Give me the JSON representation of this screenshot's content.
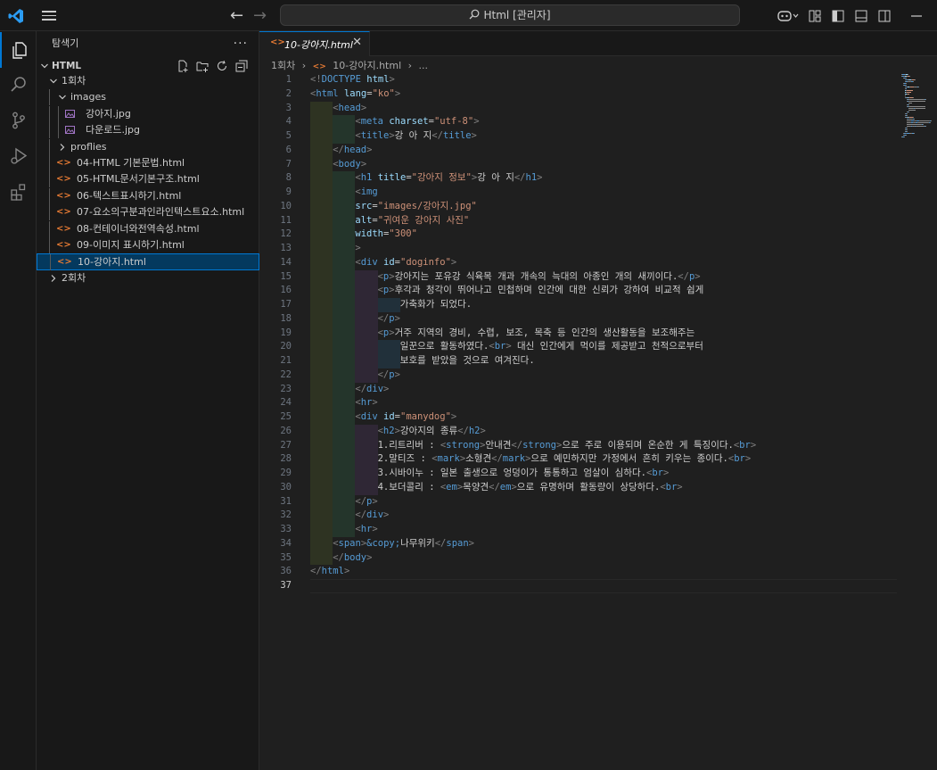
{
  "titlebar": {
    "search_text": "Html [관리자]"
  },
  "sidebar": {
    "header": "탐색기",
    "more": "···",
    "section": "HTML",
    "tree": [
      {
        "label": "1회차",
        "type": "folder",
        "depth": 1,
        "open": true
      },
      {
        "label": "images",
        "type": "folder",
        "depth": 2,
        "open": true
      },
      {
        "label": "강아지.jpg",
        "type": "image",
        "depth": 3
      },
      {
        "label": "다운로드.jpg",
        "type": "image",
        "depth": 3
      },
      {
        "label": "proflies",
        "type": "folder",
        "depth": 2,
        "open": false
      },
      {
        "label": "04-HTML 기본문법.html",
        "type": "html",
        "depth": 2
      },
      {
        "label": "05-HTML문서기본구조.html",
        "type": "html",
        "depth": 2
      },
      {
        "label": "06-텍스트표시하기.html",
        "type": "html",
        "depth": 2
      },
      {
        "label": "07-요소의구분과인라인텍스트요소.html",
        "type": "html",
        "depth": 2
      },
      {
        "label": "08-컨테이너와전역속성.html",
        "type": "html",
        "depth": 2
      },
      {
        "label": "09-이미지 표시하기.html",
        "type": "html",
        "depth": 2
      },
      {
        "label": "10-강아지.html",
        "type": "html",
        "depth": 2,
        "selected": true
      },
      {
        "label": "2회차",
        "type": "folder",
        "depth": 1,
        "open": false
      }
    ]
  },
  "editor": {
    "tab": {
      "label": "10-강아지.html",
      "icon": "html-file-icon"
    },
    "breadcrumb": [
      "1회차",
      "10-강아지.html",
      "..."
    ],
    "current_line": 37,
    "lines": [
      {
        "n": 1,
        "indent": 0,
        "segs": [
          [
            "p",
            "<!"
          ],
          [
            "t",
            "DOCTYPE"
          ],
          [
            "x",
            " "
          ],
          [
            "a",
            "html"
          ],
          [
            "p",
            ">"
          ]
        ]
      },
      {
        "n": 2,
        "indent": 0,
        "segs": [
          [
            "p",
            "<"
          ],
          [
            "t",
            "html"
          ],
          [
            "x",
            " "
          ],
          [
            "a",
            "lang"
          ],
          [
            "x",
            "="
          ],
          [
            "s",
            "\"ko\""
          ],
          [
            "p",
            ">"
          ]
        ]
      },
      {
        "n": 3,
        "indent": 1,
        "segs": [
          [
            "p",
            "<"
          ],
          [
            "t",
            "head"
          ],
          [
            "p",
            ">"
          ]
        ]
      },
      {
        "n": 4,
        "indent": 2,
        "segs": [
          [
            "p",
            "<"
          ],
          [
            "t",
            "meta"
          ],
          [
            "x",
            " "
          ],
          [
            "a",
            "charset"
          ],
          [
            "x",
            "="
          ],
          [
            "s",
            "\"utf-8\""
          ],
          [
            "p",
            ">"
          ]
        ]
      },
      {
        "n": 5,
        "indent": 2,
        "segs": [
          [
            "p",
            "<"
          ],
          [
            "t",
            "title"
          ],
          [
            "p",
            ">"
          ],
          [
            "x",
            "강 아 지"
          ],
          [
            "p",
            "</"
          ],
          [
            "t",
            "title"
          ],
          [
            "p",
            ">"
          ]
        ]
      },
      {
        "n": 6,
        "indent": 1,
        "segs": [
          [
            "p",
            "</"
          ],
          [
            "t",
            "head"
          ],
          [
            "p",
            ">"
          ]
        ]
      },
      {
        "n": 7,
        "indent": 1,
        "segs": [
          [
            "p",
            "<"
          ],
          [
            "t",
            "body"
          ],
          [
            "p",
            ">"
          ]
        ]
      },
      {
        "n": 8,
        "indent": 2,
        "segs": [
          [
            "p",
            "<"
          ],
          [
            "t",
            "h1"
          ],
          [
            "x",
            " "
          ],
          [
            "a",
            "title"
          ],
          [
            "x",
            "="
          ],
          [
            "s",
            "\"강아지 정보\""
          ],
          [
            "p",
            ">"
          ],
          [
            "x",
            "강 아 지"
          ],
          [
            "p",
            "</"
          ],
          [
            "t",
            "h1"
          ],
          [
            "p",
            ">"
          ]
        ]
      },
      {
        "n": 9,
        "indent": 2,
        "segs": [
          [
            "p",
            "<"
          ],
          [
            "t",
            "img"
          ]
        ]
      },
      {
        "n": 10,
        "indent": 2,
        "segs": [
          [
            "a",
            "src"
          ],
          [
            "x",
            "="
          ],
          [
            "s",
            "\"images/강아지.jpg\""
          ]
        ]
      },
      {
        "n": 11,
        "indent": 2,
        "segs": [
          [
            "a",
            "alt"
          ],
          [
            "x",
            "="
          ],
          [
            "s",
            "\"귀여운 강아지 사진\""
          ]
        ]
      },
      {
        "n": 12,
        "indent": 2,
        "segs": [
          [
            "a",
            "width"
          ],
          [
            "x",
            "="
          ],
          [
            "s",
            "\"300\""
          ]
        ]
      },
      {
        "n": 13,
        "indent": 2,
        "segs": [
          [
            "p",
            ">"
          ]
        ]
      },
      {
        "n": 14,
        "indent": 2,
        "segs": [
          [
            "p",
            "<"
          ],
          [
            "t",
            "div"
          ],
          [
            "x",
            " "
          ],
          [
            "a",
            "id"
          ],
          [
            "x",
            "="
          ],
          [
            "s",
            "\"doginfo\""
          ],
          [
            "p",
            ">"
          ]
        ]
      },
      {
        "n": 15,
        "indent": 3,
        "segs": [
          [
            "p",
            "<"
          ],
          [
            "t",
            "p"
          ],
          [
            "p",
            ">"
          ],
          [
            "x",
            "강아지는 포유강 식육목 개과 개속의 늑대의 아종인 개의 새끼이다."
          ],
          [
            "p",
            "</"
          ],
          [
            "t",
            "p"
          ],
          [
            "p",
            ">"
          ]
        ]
      },
      {
        "n": 16,
        "indent": 3,
        "segs": [
          [
            "p",
            "<"
          ],
          [
            "t",
            "p"
          ],
          [
            "p",
            ">"
          ],
          [
            "x",
            "후각과 청각이 뛰어나고 민첩하며 인간에 대한 신뢰가 강하여 비교적 쉽게"
          ]
        ]
      },
      {
        "n": 17,
        "indent": 4,
        "segs": [
          [
            "x",
            "가축화가 되었다."
          ]
        ]
      },
      {
        "n": 18,
        "indent": 3,
        "segs": [
          [
            "p",
            "</"
          ],
          [
            "t",
            "p"
          ],
          [
            "p",
            ">"
          ]
        ]
      },
      {
        "n": 19,
        "indent": 3,
        "segs": [
          [
            "p",
            "<"
          ],
          [
            "t",
            "p"
          ],
          [
            "p",
            ">"
          ],
          [
            "x",
            "거주 지역의 경비, 수렵, 보조, 목축 등 인간의 생산활동을 보조해주는"
          ]
        ]
      },
      {
        "n": 20,
        "indent": 4,
        "segs": [
          [
            "x",
            "일꾼으로 활동하였다."
          ],
          [
            "p",
            "<"
          ],
          [
            "t",
            "br"
          ],
          [
            "p",
            ">"
          ],
          [
            "x",
            " 대신 인간에게 먹이를 제공받고 천적으로부터"
          ]
        ]
      },
      {
        "n": 21,
        "indent": 4,
        "segs": [
          [
            "x",
            "보호를 받았을 것으로 여겨진다."
          ]
        ]
      },
      {
        "n": 22,
        "indent": 3,
        "segs": [
          [
            "p",
            "</"
          ],
          [
            "t",
            "p"
          ],
          [
            "p",
            ">"
          ]
        ]
      },
      {
        "n": 23,
        "indent": 2,
        "segs": [
          [
            "p",
            "</"
          ],
          [
            "t",
            "div"
          ],
          [
            "p",
            ">"
          ]
        ]
      },
      {
        "n": 24,
        "indent": 2,
        "segs": [
          [
            "p",
            "<"
          ],
          [
            "t",
            "hr"
          ],
          [
            "p",
            ">"
          ]
        ]
      },
      {
        "n": 25,
        "indent": 2,
        "segs": [
          [
            "p",
            "<"
          ],
          [
            "t",
            "div"
          ],
          [
            "x",
            " "
          ],
          [
            "a",
            "id"
          ],
          [
            "x",
            "="
          ],
          [
            "s",
            "\"manydog\""
          ],
          [
            "p",
            ">"
          ]
        ]
      },
      {
        "n": 26,
        "indent": 3,
        "segs": [
          [
            "p",
            "<"
          ],
          [
            "t",
            "h2"
          ],
          [
            "p",
            ">"
          ],
          [
            "x",
            "강아지의 종류"
          ],
          [
            "p",
            "</"
          ],
          [
            "t",
            "h2"
          ],
          [
            "p",
            ">"
          ]
        ]
      },
      {
        "n": 27,
        "indent": 3,
        "segs": [
          [
            "x",
            "1.리트리버 : "
          ],
          [
            "p",
            "<"
          ],
          [
            "t",
            "strong"
          ],
          [
            "p",
            ">"
          ],
          [
            "x",
            "안내견"
          ],
          [
            "p",
            "</"
          ],
          [
            "t",
            "strong"
          ],
          [
            "p",
            ">"
          ],
          [
            "x",
            "으로 주로 이용되며 온순한 게 특징이다."
          ],
          [
            "p",
            "<"
          ],
          [
            "t",
            "br"
          ],
          [
            "p",
            ">"
          ]
        ]
      },
      {
        "n": 28,
        "indent": 3,
        "segs": [
          [
            "x",
            "2.말티즈 : "
          ],
          [
            "p",
            "<"
          ],
          [
            "t",
            "mark"
          ],
          [
            "p",
            ">"
          ],
          [
            "x",
            "소형견"
          ],
          [
            "p",
            "</"
          ],
          [
            "t",
            "mark"
          ],
          [
            "p",
            ">"
          ],
          [
            "x",
            "으로 예민하지만 가정에서 흔히 키우는 종이다."
          ],
          [
            "p",
            "<"
          ],
          [
            "t",
            "br"
          ],
          [
            "p",
            ">"
          ]
        ]
      },
      {
        "n": 29,
        "indent": 3,
        "segs": [
          [
            "x",
            "3.시바이누 : 일본 출생으로 엉덩이가 통통하고 엄살이 심하다."
          ],
          [
            "p",
            "<"
          ],
          [
            "t",
            "br"
          ],
          [
            "p",
            ">"
          ]
        ]
      },
      {
        "n": 30,
        "indent": 3,
        "segs": [
          [
            "x",
            "4.보더콜리 : "
          ],
          [
            "p",
            "<"
          ],
          [
            "t",
            "em"
          ],
          [
            "p",
            ">"
          ],
          [
            "x",
            "목양견"
          ],
          [
            "p",
            "</"
          ],
          [
            "t",
            "em"
          ],
          [
            "p",
            ">"
          ],
          [
            "x",
            "으로 유명하며 활동량이 상당하다."
          ],
          [
            "p",
            "<"
          ],
          [
            "t",
            "br"
          ],
          [
            "p",
            ">"
          ]
        ]
      },
      {
        "n": 31,
        "indent": 2,
        "segs": [
          [
            "p",
            "</"
          ],
          [
            "t",
            "p"
          ],
          [
            "p",
            ">"
          ]
        ]
      },
      {
        "n": 32,
        "indent": 2,
        "segs": [
          [
            "p",
            "</"
          ],
          [
            "t",
            "div"
          ],
          [
            "p",
            ">"
          ]
        ]
      },
      {
        "n": 33,
        "indent": 2,
        "segs": [
          [
            "p",
            "<"
          ],
          [
            "t",
            "hr"
          ],
          [
            "p",
            ">"
          ]
        ]
      },
      {
        "n": 34,
        "indent": 1,
        "segs": [
          [
            "p",
            "<"
          ],
          [
            "t",
            "span"
          ],
          [
            "p",
            ">"
          ],
          [
            "e",
            "&copy;"
          ],
          [
            "x",
            "나무위키"
          ],
          [
            "p",
            "</"
          ],
          [
            "t",
            "span"
          ],
          [
            "p",
            ">"
          ]
        ]
      },
      {
        "n": 35,
        "indent": 1,
        "segs": [
          [
            "p",
            "</"
          ],
          [
            "t",
            "body"
          ],
          [
            "p",
            ">"
          ]
        ]
      },
      {
        "n": 36,
        "indent": 0,
        "segs": [
          [
            "p",
            "</"
          ],
          [
            "t",
            "html"
          ],
          [
            "p",
            ">"
          ]
        ]
      },
      {
        "n": 37,
        "indent": 0,
        "segs": []
      }
    ]
  },
  "colors": {
    "accent": "#0078d4",
    "indent_guides": [
      "#2e3322",
      "#24352b",
      "#2f2735",
      "#21303a"
    ]
  }
}
